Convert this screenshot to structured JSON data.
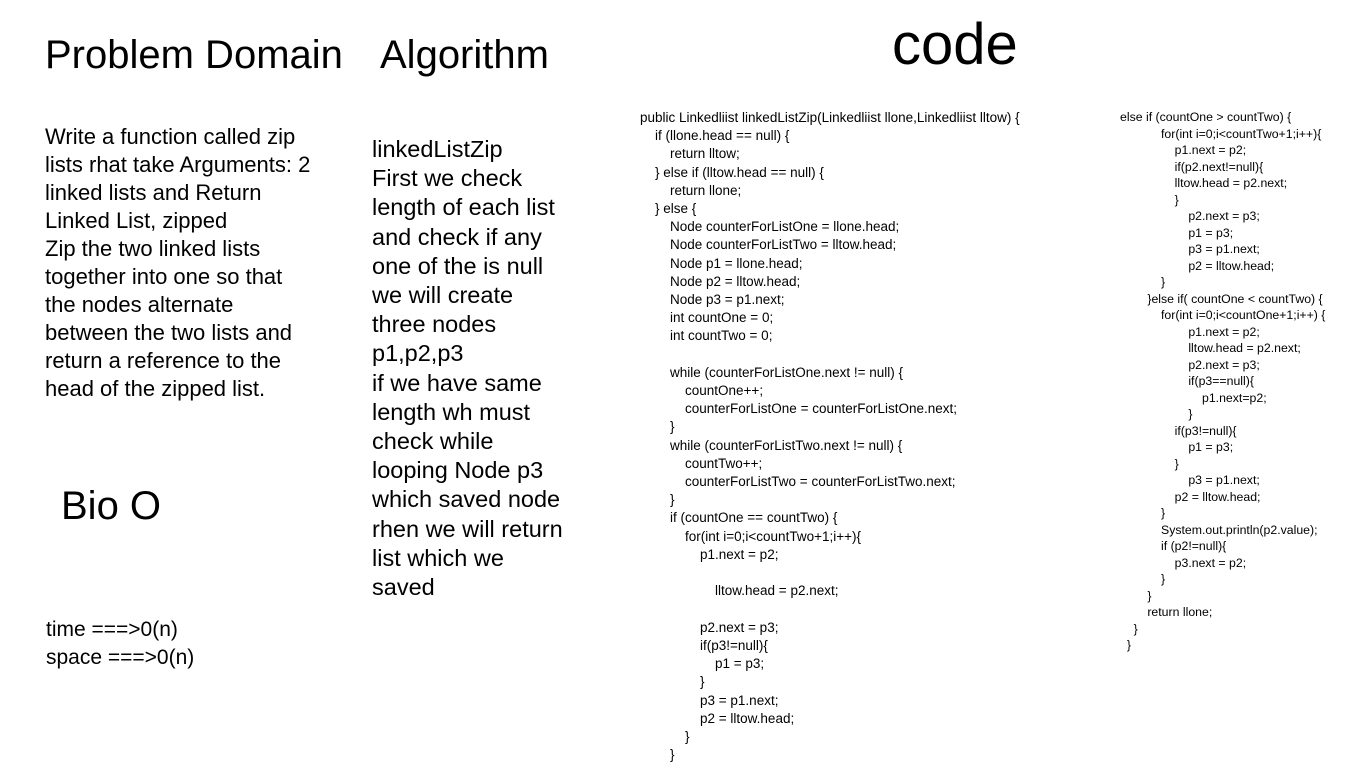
{
  "headings": {
    "problem_domain": "Problem Domain",
    "algorithm": "Algorithm",
    "code": "code",
    "big_o": "Bio O"
  },
  "problem_text": "Write a function called zip\nlists rhat take Arguments: 2\nlinked lists and Return\nLinked List, zipped\nZip the two linked lists\ntogether into one so that\nthe nodes alternate\nbetween the two lists and\nreturn a reference to the\nhead of the zipped list.",
  "algorithm_text": "linkedListZip\nFirst we check\nlength of each list\nand check if any\none of the is null\nwe will create\nthree nodes\np1,p2,p3\nif we have same\nlength  wh must\ncheck while\nlooping Node p3\nwhich saved node\nrhen we will return\nlist which we\nsaved",
  "complexity_text": "time ===>0(n)\nspace ===>0(n)",
  "code_main": "public Linkedliist linkedListZip(Linkedliist llone,Linkedliist lltow) {\n    if (llone.head == null) {\n        return lltow;\n    } else if (lltow.head == null) {\n        return llone;\n    } else {\n        Node counterForListOne = llone.head;\n        Node counterForListTwo = lltow.head;\n        Node p1 = llone.head;\n        Node p2 = lltow.head;\n        Node p3 = p1.next;\n        int countOne = 0;\n        int countTwo = 0;\n\n        while (counterForListOne.next != null) {\n            countOne++;\n            counterForListOne = counterForListOne.next;\n        }\n        while (counterForListTwo.next != null) {\n            countTwo++;\n            counterForListTwo = counterForListTwo.next;\n        }\n        if (countOne == countTwo) {\n            for(int i=0;i<countTwo+1;i++){\n                p1.next = p2;\n\n                    lltow.head = p2.next;\n\n                p2.next = p3;\n                if(p3!=null){\n                    p1 = p3;\n                }\n                p3 = p1.next;\n                p2 = lltow.head;\n            }\n        }",
  "code_side": "else if (countOne > countTwo) {\n            for(int i=0;i<countTwo+1;i++){\n                p1.next = p2;\n                if(p2.next!=null){\n                lltow.head = p2.next;\n                }\n                    p2.next = p3;\n                    p1 = p3;\n                    p3 = p1.next;\n                    p2 = lltow.head;\n            }\n        }else if( countOne < countTwo) {\n            for(int i=0;i<countOne+1;i++) {\n                    p1.next = p2;\n                    lltow.head = p2.next;\n                    p2.next = p3;\n                    if(p3==null){\n                        p1.next=p2;\n                    }\n                if(p3!=null){\n                    p1 = p3;\n                }\n                    p3 = p1.next;\n                p2 = lltow.head;\n            }\n            System.out.println(p2.value);\n            if (p2!=null){\n                p3.next = p2;\n            }\n        }\n        return llone;\n    }\n  }"
}
